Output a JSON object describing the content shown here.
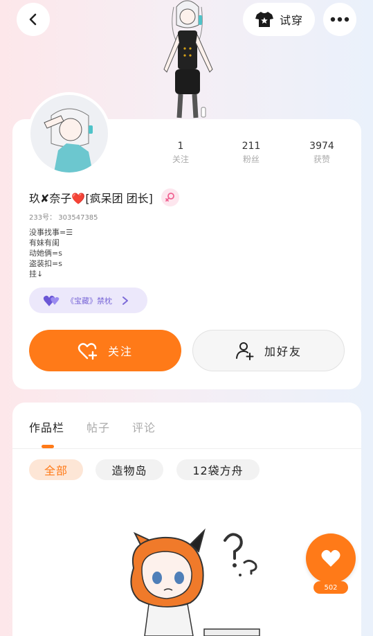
{
  "header": {
    "try_on_label": "试穿",
    "icons": {
      "back": "chevron-left-icon",
      "try_on": "outfit-icon",
      "more": "more-dots-icon"
    }
  },
  "profile": {
    "name": "玖✘奈子❤️[疯呆团   团长]",
    "uid": "233号： 303547385",
    "bio": [
      "没事找事=☰",
      "有妹有闺",
      "动她俩=s",
      "盗装扣=s",
      "挂↓"
    ],
    "title_badge": "《宝藏》禁枕"
  },
  "stats": [
    {
      "value": "1",
      "label": "关注"
    },
    {
      "value": "211",
      "label": "粉丝"
    },
    {
      "value": "3974",
      "label": "获赞"
    }
  ],
  "actions": {
    "follow_label": "关注",
    "add_friend_label": "加好友"
  },
  "content": {
    "tabs": [
      "作品栏",
      "帖子",
      "评论"
    ],
    "active_tab": 0,
    "filters": [
      "全部",
      "造物岛",
      "12袋方舟"
    ],
    "active_filter": 0
  },
  "like": {
    "count": "502"
  },
  "colors": {
    "accent": "#ff7a18",
    "badge_purple": "#7c6ad8",
    "gender_pink": "#f06292"
  }
}
